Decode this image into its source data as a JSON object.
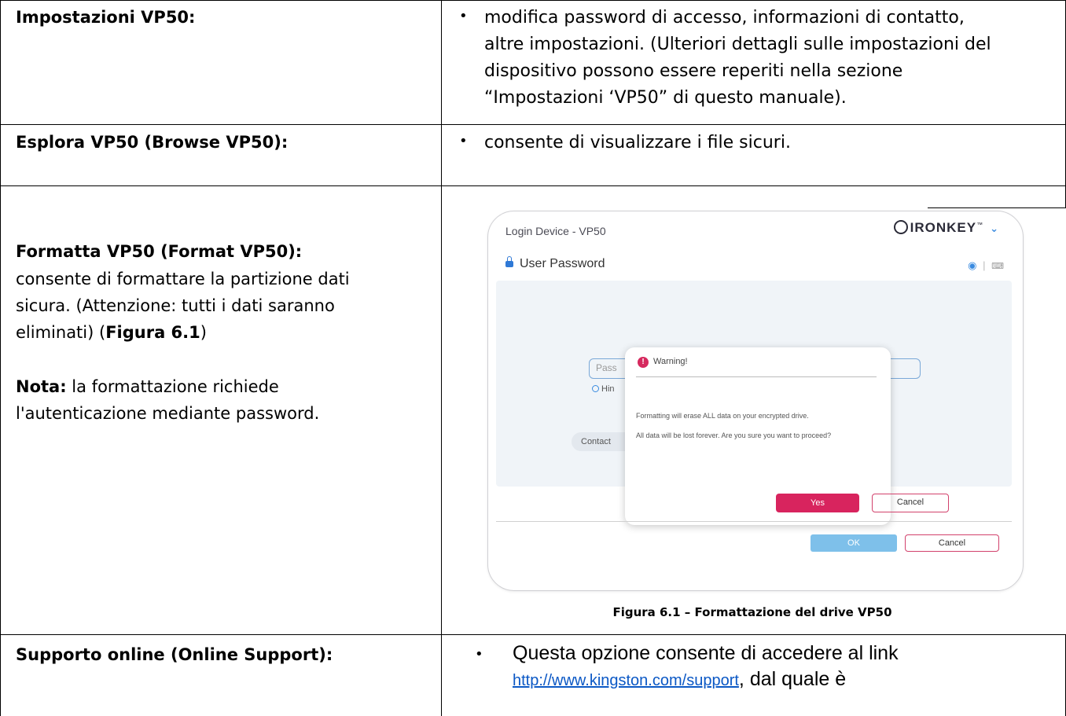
{
  "rows": [
    {
      "label": "Impostazioni VP50:",
      "bullet_lines": [
        "modifica password di accesso, informazioni di contatto,",
        "altre impostazioni. (Ulteriori dettagli sulle impostazioni del",
        "dispositivo possono essere reperiti nella sezione",
        "“Impostazioni ‘VP50” di questo manuale)."
      ]
    },
    {
      "label": "Esplora VP50 (Browse VP50):",
      "bullet_lines": [
        "consente di visualizzare i file sicuri."
      ]
    },
    {
      "label": "Formatta VP50 (Format VP50):",
      "desc_lines": [
        "consente di formattare la partizione dati",
        "sicura. (Attenzione: tutti i dati saranno"
      ],
      "desc_line3_pre": "eliminati) (",
      "desc_line3_bold": "Figura 6.1",
      "desc_line3_post": ")",
      "note_label": "Nota:",
      "note_text_1": " la formattazione richiede",
      "note_text_2": "l'autenticazione mediante password.",
      "figure_caption": "Figura 6.1 – Formattazione del drive VP50"
    },
    {
      "label": "Supporto online (Online Support):",
      "bullet_line1": "Questa opzione consente di accedere al link",
      "bullet_link": "http://www.kingston.com/support",
      "bullet_line2_post": ", dal quale è"
    }
  ],
  "dialog": {
    "title": "Login Device - VP50",
    "brand": "IRONKEY",
    "trademark": "™",
    "section": "User Password",
    "password_placeholder": "Pass",
    "hint_label": "Hin",
    "contact_label": "Contact",
    "ok_label": "OK",
    "cancel_label": "Cancel",
    "warning": {
      "title": "Warning!",
      "message_1": "Formatting will erase ALL data on your encrypted drive.",
      "message_2": "All data will be lost forever. Are you sure you want to proceed?",
      "yes_label": "Yes",
      "cancel_label": "Cancel"
    },
    "colors": {
      "accent_blue": "#3a8be0",
      "danger_pink": "#d8245e",
      "ok_disabled": "#7ec0ea"
    }
  }
}
